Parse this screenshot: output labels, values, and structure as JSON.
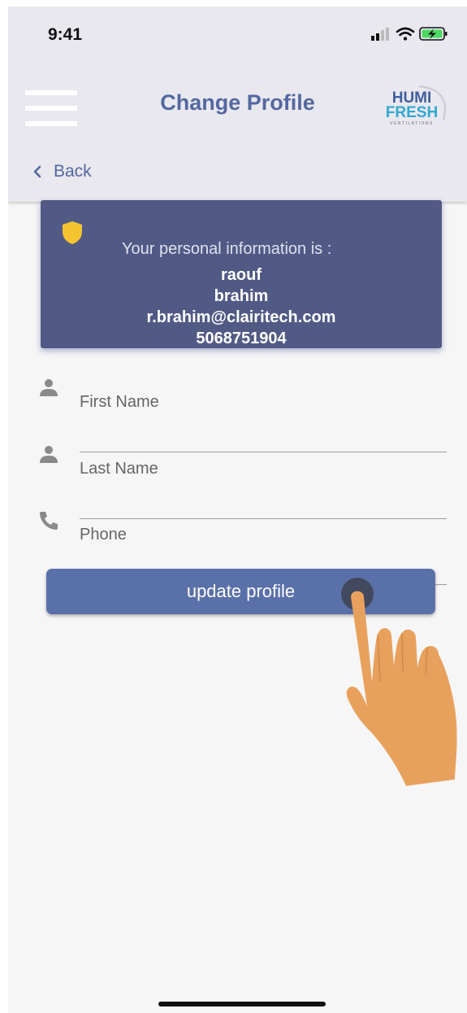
{
  "status_bar": {
    "time": "9:41",
    "icons": [
      "signal-icon",
      "wifi-icon",
      "battery-charging-icon"
    ]
  },
  "app_bar": {
    "title": "Change Profile",
    "logo_line1": "HUMI",
    "logo_line2": "FRESH",
    "logo_tagline": "VENTILATIONS"
  },
  "back": {
    "label": "Back"
  },
  "info_card": {
    "header": "Your personal information is :",
    "first_name": "raouf",
    "last_name": "brahim",
    "email": "r.brahim@clairitech.com",
    "phone": "5068751904",
    "shield_color": "#f4c430"
  },
  "form": {
    "first_name_placeholder": "First Name",
    "last_name_placeholder": "Last Name",
    "phone_placeholder": "Phone",
    "update_label": "update profile"
  },
  "colors": {
    "accent": "#5468a0",
    "card": "#515a85",
    "button": "#5a70a8",
    "hand": "#e8a15d"
  }
}
